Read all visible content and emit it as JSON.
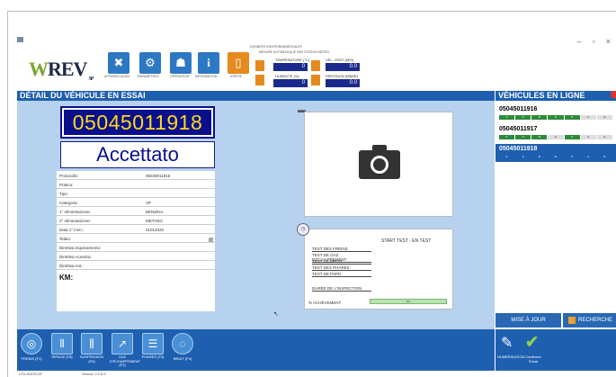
{
  "window": {
    "minimize": "–",
    "maximize": "▫",
    "close": "×"
  },
  "logo": {
    "first": "W",
    "rest": "REV",
    "suffix": "SP"
  },
  "toolbar": [
    {
      "name": "tool-appareillages",
      "icon": "tools-icon",
      "glyph": "✖",
      "label": "APPAREILLAGES"
    },
    {
      "name": "tool-parametres",
      "icon": "gear-icon",
      "glyph": "⚙",
      "label": "PARAMÈTRES"
    },
    {
      "name": "tool-operateur",
      "icon": "user-icon",
      "glyph": "☗",
      "label": "OPÉRATEUR"
    },
    {
      "name": "tool-information",
      "icon": "info-icon",
      "glyph": "i",
      "label": "INFORMATION"
    },
    {
      "name": "tool-sortie",
      "icon": "exit-door-icon",
      "glyph": "▯",
      "label": "SORTIE"
    }
  ],
  "measurements": {
    "title": "DONNÉES ENVIRONNEMENTALES",
    "subtitle": "MESURE AUTOMATIQUE PAR STATION MÉTÉO",
    "temp_label": "TEMPÉRATURE (°C)",
    "temp_value": "0",
    "humidity_label": "HUMIDITÉ (%)",
    "humidity_value": "0",
    "wind_label": "VEL. VENT (M/S)",
    "wind_value": "0.0",
    "pressure_label": "PRESSION (MBAR)",
    "pressure_value": "0.0"
  },
  "detail": {
    "header": "DÉTAIL DU VÉHICULE EN ESSAI",
    "plate": "05045011918",
    "status": "Accettato",
    "rows": [
      {
        "k": "Protocollo:",
        "v": "05045011918"
      },
      {
        "k": "Pratica:",
        "v": ""
      },
      {
        "k": "Tipo:",
        "v": ""
      },
      {
        "k": "Categoria:",
        "v": "VP"
      },
      {
        "k": "1° Alimentazione:",
        "v": "BENZINA"
      },
      {
        "k": "2° Alimentazione:",
        "v": "METANO"
      },
      {
        "k": "Data 1° imm.:",
        "v": "01012020"
      },
      {
        "k": "Telaio:",
        "v": ""
      },
      {
        "k": "Direttiva Inquinamento:",
        "v": ""
      },
      {
        "k": "Direttiva Acustica:",
        "v": ""
      },
      {
        "k": "Direttiva Ant.:",
        "v": ""
      }
    ],
    "km_label": "KM:"
  },
  "tests": {
    "start": "START TEST - EN TEST",
    "items": [
      "TEST DES FREINS",
      "TEST DE GAZ D'ÉCHAPPEMENT",
      "TEST DE BRUIT",
      "TEST DES PHARES",
      "TEST DE PSPD"
    ],
    "duration": "DURÉE DE L'INSPECTION",
    "percent_label": "% ACHÈVEMENT",
    "percent_value": "0%"
  },
  "online": {
    "header": "VÉHICULES EN LIGNE",
    "vehicles": [
      {
        "plate": "05045011916",
        "strip": [
          "F",
          "S",
          "B",
          "E",
          "P",
          "A",
          "E"
        ],
        "selected": false
      },
      {
        "plate": "05045011917",
        "strip": [
          "F",
          "S",
          "B",
          "E",
          "P",
          "A",
          "E"
        ],
        "selected": false
      },
      {
        "plate": "05045011918",
        "strip": [
          "F",
          "S",
          "B",
          "E",
          "P",
          "A",
          "E"
        ],
        "selected": true
      }
    ],
    "update_label": "MISE À JOUR",
    "search_label": "RECHERCHE"
  },
  "bottom": [
    {
      "name": "freins-button",
      "icon": "brake-disc-icon",
      "glyph": "◎",
      "label": "FREINS (F1)"
    },
    {
      "name": "ripage-button",
      "icon": "sideslip-icon",
      "glyph": "⫴",
      "label": "RIPAGE (F8)"
    },
    {
      "name": "suspension-button",
      "icon": "suspension-icon",
      "glyph": "⫼",
      "label": "SUSPENSION (F9)"
    },
    {
      "name": "gaz-button",
      "icon": "exhaust-icon",
      "glyph": "↗",
      "label": "GAZ D'ÉCHAPPEMENT (F2)"
    },
    {
      "name": "phares-button",
      "icon": "headlight-icon",
      "glyph": "☰",
      "label": "PHARES (F3)"
    },
    {
      "name": "bruit-button",
      "icon": "noise-icon",
      "glyph": "◌",
      "label": "BRUIT (F4)"
    }
  ],
  "bottom_right": {
    "pen_label": "NUMÉRISATION",
    "confirm_label": "Confirmer Essai"
  },
  "statusbar": {
    "left": "UTILISATEUR",
    "version": "Version 2.0.8.9"
  }
}
